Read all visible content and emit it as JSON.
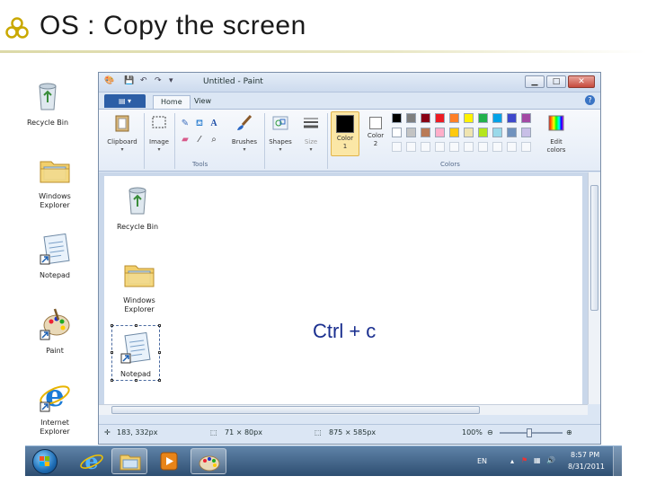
{
  "slide": {
    "title": "OS : Copy the screen",
    "annotation": "Ctrl + c"
  },
  "desktop": {
    "icons": [
      {
        "label": "Recycle Bin",
        "icon": "recycle-bin-icon"
      },
      {
        "label": "Windows Explorer",
        "icon": "folder-icon"
      },
      {
        "label": "Notepad",
        "icon": "notepad-icon"
      },
      {
        "label": "Paint",
        "icon": "paint-palette-icon"
      },
      {
        "label": "Internet Explorer",
        "icon": "internet-explorer-icon"
      }
    ]
  },
  "paint": {
    "title": "Untitled - Paint",
    "tabs": {
      "file": "",
      "home": "Home",
      "view": "View"
    },
    "ribbon": {
      "clipboard": "Clipboard",
      "image": "Image",
      "tools": "Tools",
      "brushes": "Brushes",
      "shapes": "Shapes",
      "size": "Size",
      "color1": "Color\n1",
      "color1_a": "Color",
      "color1_b": "1",
      "color2_a": "Color",
      "color2_b": "2",
      "colors": "Colors",
      "edit_colors_a": "Edit",
      "edit_colors_b": "colors",
      "text_tool": "A"
    },
    "palette_row1": [
      "#000000",
      "#7f7f7f",
      "#880015",
      "#ed1c24",
      "#ff7f27",
      "#fff200",
      "#22b14c",
      "#00a2e8",
      "#3f48cc",
      "#a349a4"
    ],
    "palette_row2": [
      "#ffffff",
      "#c3c3c3",
      "#b97a57",
      "#ffaec9",
      "#ffc90e",
      "#efe4b0",
      "#b5e61d",
      "#99d9ea",
      "#7092be",
      "#c8bfe7"
    ],
    "canvas_icons": [
      {
        "label": "Recycle Bin"
      },
      {
        "label": "Windows Explorer"
      },
      {
        "label": "Notepad"
      }
    ],
    "status": {
      "cursor": "183, 332px",
      "selection": "71 × 80px",
      "size": "875 × 585px",
      "zoom": "100%"
    }
  },
  "taskbar": {
    "language": "EN",
    "time": "8:57 PM",
    "date": "8/31/2011"
  },
  "colors": {
    "accent": "#2c5ea6",
    "annotation": "#1a2f8f"
  }
}
